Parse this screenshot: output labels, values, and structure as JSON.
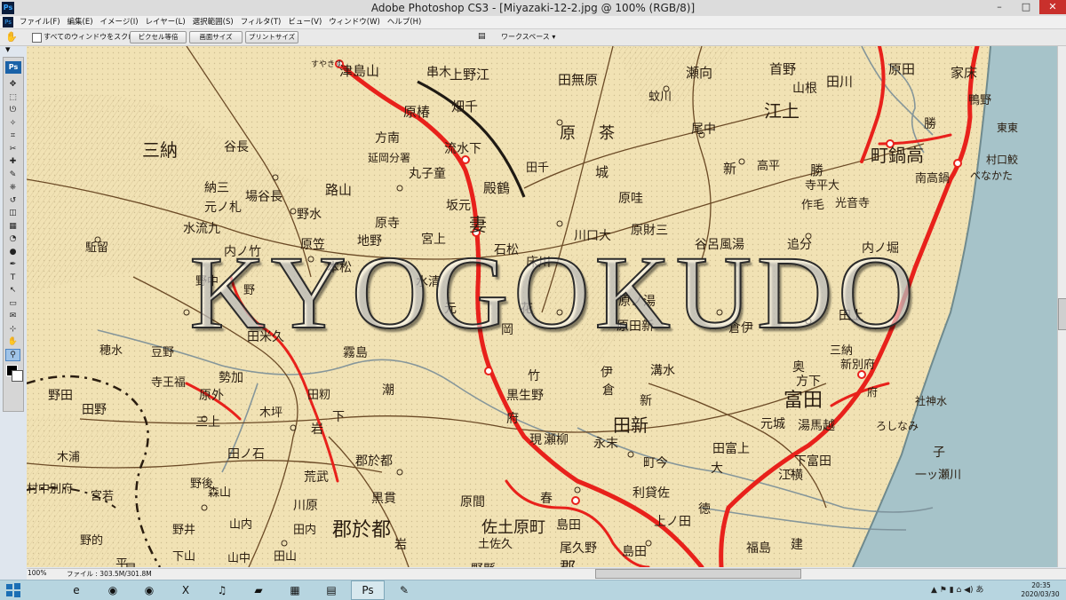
{
  "window": {
    "title": "Adobe Photoshop CS3 - [Miyazaki-12-2.jpg @ 100% (RGB/8)]",
    "app_icon_text": "Ps",
    "controls": {
      "minimize": "–",
      "maximize": "□",
      "close": "✕"
    }
  },
  "menu": {
    "items": [
      "ファイル(F)",
      "編集(E)",
      "イメージ(I)",
      "レイヤー(L)",
      "選択範囲(S)",
      "フィルタ(T)",
      "ビュー(V)",
      "ウィンドウ(W)",
      "ヘルプ(H)"
    ]
  },
  "options": {
    "scroll_all_label": "すべてのウィンドウをスクロール",
    "actual_pixels": "ピクセル等倍",
    "fit_screen": "画面サイズ",
    "print_size": "プリントサイズ",
    "workspace_label": "ワークスペース ▾"
  },
  "toolbox": {
    "badge": "Ps",
    "tools": [
      "move-icon",
      "marquee-icon",
      "lasso-icon",
      "magic-wand-icon",
      "crop-icon",
      "slice-icon",
      "healing-icon",
      "brush-icon",
      "stamp-icon",
      "history-brush-icon",
      "eraser-icon",
      "gradient-icon",
      "blur-icon",
      "dodge-icon",
      "pen-icon",
      "type-icon",
      "path-select-icon",
      "shape-icon",
      "notes-icon",
      "eyedropper-icon",
      "hand-icon",
      "zoom-icon"
    ],
    "glyphs": [
      "✥",
      "⬚",
      "ᘎ",
      "✧",
      "⌗",
      "✂",
      "✚",
      "✎",
      "⎈",
      "↺",
      "◫",
      "▦",
      "◔",
      "●",
      "✒",
      "T",
      "↖",
      "▭",
      "✉",
      "⊹",
      "✋",
      "⚲"
    ],
    "active_tool_index": 21
  },
  "canvas": {
    "watermark": "KYOGOKUDO",
    "labels": [
      "津島山",
      "すやきす",
      "上野江",
      "田無原",
      "串木",
      "畑千",
      "原椿",
      "瀬向",
      "首野",
      "田川",
      "原田",
      "家床",
      "蚊川",
      "江上",
      "山根",
      "勝",
      "鴨野",
      "三納",
      "谷長",
      "流水下",
      "方南",
      "原",
      "茶",
      "尾中",
      "町鍋高",
      "南高鍋",
      "延岡分署",
      "丸子童",
      "田千",
      "松本",
      "多",
      "高平",
      "勝",
      "寺平大",
      "新",
      "城",
      "納三",
      "場谷長",
      "路山",
      "殿鶴",
      "原哇",
      "谷子",
      "作毛",
      "光音寺",
      "元ノ札",
      "坂元",
      "原豊",
      "水流九",
      "野水",
      "原寺",
      "地野",
      "宮上",
      "妻",
      "川口大",
      "原財三",
      "谷呂風湯",
      "追分",
      "内ノ堀",
      "内ノ竹",
      "原笠",
      "石松",
      "床川",
      "田町",
      "久野",
      "呂米",
      "新",
      "本松",
      "野中",
      "尾鈴",
      "原ノ湯",
      "原田新",
      "倉伊",
      "田上",
      "三納",
      "納三",
      "穂北",
      "水清",
      "元",
      "花",
      "穂",
      "杉",
      "田米久",
      "野豆",
      "奥",
      "方下",
      "新別府",
      "園",
      "町",
      "田下",
      "郡町",
      "勢加",
      "原外",
      "寺王福",
      "黒生野",
      "竹",
      "伊",
      "田新",
      "倉",
      "溝水",
      "新",
      "富田",
      "田富",
      "浜",
      "元城",
      "塚野",
      "田野",
      "田富上",
      "下富田",
      "湯馬越",
      "本城",
      "岩",
      "三上",
      "三ノ田",
      "木浦",
      "木坪",
      "筒府",
      "都於郡",
      "現",
      "瀬柳",
      "永末",
      "町今",
      "大",
      "江横",
      "十弓",
      "宮若",
      "村中別府",
      "野後",
      "森山",
      "荒武",
      "川原",
      "黒貫",
      "原間",
      "子",
      "島田",
      "佐土原町",
      "利貸佐",
      "上ノ田",
      "徳",
      "野井",
      "山内",
      "郡於都",
      "岩",
      "田内",
      "山中",
      "田山",
      "佐土原",
      "尾久野",
      "久保土",
      "下山",
      "星",
      "島田",
      "建",
      "福島",
      "的野",
      "小",
      "瓜",
      "野"
    ],
    "placed": [
      [
        352,
        18,
        "津島山",
        15
      ],
      [
        320,
        14,
        "すやきす",
        9
      ],
      [
        450,
        20,
        "串木",
        14
      ],
      [
        476,
        22,
        "上野江",
        15
      ],
      [
        598,
        28,
        "田無原",
        15
      ],
      [
        478,
        58,
        "畑千",
        15
      ],
      [
        424,
        64,
        "原椿",
        15
      ],
      [
        742,
        20,
        "瀬向",
        15
      ],
      [
        836,
        16,
        "首野",
        15
      ],
      [
        900,
        30,
        "田川",
        15
      ],
      [
        970,
        16,
        "原田",
        15
      ],
      [
        1040,
        20,
        "家床",
        15
      ],
      [
        700,
        48,
        "蚊川",
        13
      ],
      [
        830,
        60,
        "江上",
        20
      ],
      [
        862,
        38,
        "山根",
        14
      ],
      [
        1010,
        78,
        "勝",
        14
      ],
      [
        1060,
        52,
        "鴨野",
        13
      ],
      [
        130,
        104,
        "三納",
        20
      ],
      [
        222,
        104,
        "谷長",
        14
      ],
      [
        470,
        106,
        "流水下",
        14
      ],
      [
        392,
        94,
        "方南",
        14
      ],
      [
        600,
        86,
        "原",
        18
      ],
      [
        644,
        86,
        "茶",
        18
      ],
      [
        748,
        84,
        "尾中",
        14
      ],
      [
        950,
        110,
        "町鍋高",
        20
      ],
      [
        1000,
        140,
        "南高鍋",
        13
      ],
      [
        384,
        118,
        "延岡分署",
        12
      ],
      [
        430,
        134,
        "丸子童",
        14
      ],
      [
        562,
        128,
        "田千",
        13
      ],
      [
        822,
        126,
        "高平",
        13
      ],
      [
        882,
        130,
        "勝",
        15
      ],
      [
        876,
        148,
        "寺平大",
        13
      ],
      [
        784,
        128,
        "新",
        15
      ],
      [
        640,
        132,
        "城",
        15
      ],
      [
        910,
        168,
        "光音寺",
        13
      ],
      [
        872,
        170,
        "作毛",
        13
      ],
      [
        200,
        150,
        "納三",
        14
      ],
      [
        246,
        160,
        "場谷長",
        14
      ],
      [
        336,
        152,
        "路山",
        15
      ],
      [
        514,
        150,
        "殿鶴",
        15
      ],
      [
        666,
        162,
        "原哇",
        14
      ],
      [
        200,
        172,
        "元ノ札",
        14
      ],
      [
        472,
        170,
        "坂元",
        14
      ],
      [
        176,
        196,
        "水流九",
        14
      ],
      [
        304,
        180,
        "野水",
        14
      ],
      [
        392,
        190,
        "原寺",
        14
      ],
      [
        372,
        210,
        "地野",
        14
      ],
      [
        444,
        208,
        "宮上",
        14
      ],
      [
        498,
        188,
        "妻",
        20
      ],
      [
        616,
        204,
        "川口大",
        14
      ],
      [
        680,
        198,
        "原財三",
        14
      ],
      [
        752,
        214,
        "谷呂風湯",
        14
      ],
      [
        856,
        214,
        "追分",
        14
      ],
      [
        940,
        218,
        "内ノ堀",
        14
      ],
      [
        222,
        222,
        "内ノ竹",
        14
      ],
      [
        308,
        214,
        "原笠",
        14
      ],
      [
        526,
        220,
        "石松",
        14
      ],
      [
        562,
        234,
        "床川",
        14
      ],
      [
        66,
        218,
        "駈留",
        13
      ],
      [
        338,
        240,
        "本松",
        14
      ],
      [
        190,
        256,
        "野中",
        13
      ],
      [
        244,
        266,
        "野",
        13
      ],
      [
        666,
        278,
        "原ノ湯",
        14
      ],
      [
        664,
        306,
        "原田新",
        14
      ],
      [
        790,
        308,
        "倉伊",
        14
      ],
      [
        914,
        294,
        "田上",
        14
      ],
      [
        904,
        334,
        "三納",
        13
      ],
      [
        438,
        256,
        "水清",
        14
      ],
      [
        470,
        286,
        "元",
        14
      ],
      [
        556,
        286,
        "花",
        14
      ],
      [
        534,
        310,
        "岡",
        14
      ],
      [
        248,
        318,
        "田米久",
        14
      ],
      [
        140,
        336,
        "豆野",
        13
      ],
      [
        82,
        334,
        "穂水",
        13
      ],
      [
        862,
        352,
        "奥",
        14
      ],
      [
        866,
        368,
        "方下",
        14
      ],
      [
        916,
        350,
        "新別府",
        13
      ],
      [
        356,
        336,
        "霧島",
        14
      ],
      [
        400,
        378,
        "潮",
        14
      ],
      [
        316,
        384,
        "田籾",
        13
      ],
      [
        216,
        364,
        "勢加",
        14
      ],
      [
        194,
        384,
        "原外",
        14
      ],
      [
        140,
        370,
        "寺王福",
        13
      ],
      [
        540,
        384,
        "黒生野",
        14
      ],
      [
        564,
        362,
        "竹",
        14
      ],
      [
        646,
        358,
        "伊",
        14
      ],
      [
        648,
        378,
        "倉",
        14
      ],
      [
        702,
        356,
        "溝水",
        14
      ],
      [
        690,
        390,
        "新",
        14
      ],
      [
        660,
        414,
        "田新",
        20
      ],
      [
        852,
        384,
        "富田",
        22
      ],
      [
        826,
        416,
        "元城",
        14
      ],
      [
        868,
        418,
        "湯馬越",
        14
      ],
      [
        24,
        384,
        "野田",
        14
      ],
      [
        62,
        400,
        "田野",
        14
      ],
      [
        772,
        444,
        "田富上",
        14
      ],
      [
        864,
        458,
        "下富田",
        14
      ],
      [
        190,
        414,
        "三上",
        14
      ],
      [
        226,
        450,
        "田ノ石",
        14
      ],
      [
        34,
        454,
        "木浦",
        13
      ],
      [
        262,
        404,
        "木坪",
        13
      ],
      [
        320,
        422,
        "岩",
        14
      ],
      [
        344,
        408,
        "下",
        14
      ],
      [
        370,
        458,
        "郡於都",
        14
      ],
      [
        540,
        410,
        "府",
        14
      ],
      [
        566,
        434,
        "現",
        14
      ],
      [
        582,
        434,
        "瀬柳",
        14
      ],
      [
        638,
        438,
        "永末",
        14
      ],
      [
        694,
        460,
        "町今",
        14
      ],
      [
        770,
        466,
        "大",
        14
      ],
      [
        846,
        474,
        "江横",
        14
      ],
      [
        1000,
        474,
        "一ッ瀬川",
        13
      ],
      [
        72,
        498,
        "宮若",
        13
      ],
      [
        0,
        490,
        "村中別府",
        13
      ],
      [
        184,
        484,
        "野後",
        13
      ],
      [
        204,
        494,
        "森山",
        13
      ],
      [
        312,
        476,
        "荒武",
        14
      ],
      [
        300,
        508,
        "川原",
        14
      ],
      [
        388,
        500,
        "黒貫",
        14
      ],
      [
        488,
        504,
        "原間",
        14
      ],
      [
        578,
        500,
        "春",
        14
      ],
      [
        596,
        530,
        "島田",
        14
      ],
      [
        512,
        530,
        "佐土原町",
        18
      ],
      [
        682,
        494,
        "利貸佐",
        14
      ],
      [
        706,
        526,
        "上ノ田",
        14
      ],
      [
        756,
        512,
        "徳",
        14
      ],
      [
        164,
        536,
        "野井",
        13
      ],
      [
        228,
        530,
        "山内",
        13
      ],
      [
        344,
        530,
        "郡於都",
        22
      ],
      [
        300,
        536,
        "田内",
        13
      ],
      [
        414,
        552,
        "岩",
        14
      ],
      [
        226,
        568,
        "山中",
        13
      ],
      [
        278,
        566,
        "田山",
        13
      ],
      [
        508,
        552,
        "土佐久",
        13
      ],
      [
        600,
        556,
        "尾久野",
        14
      ],
      [
        670,
        560,
        "島田",
        14
      ],
      [
        164,
        566,
        "下山",
        13
      ],
      [
        110,
        580,
        "星",
        14
      ],
      [
        60,
        548,
        "野的",
        13
      ],
      [
        810,
        556,
        "福島",
        14
      ],
      [
        860,
        552,
        "建",
        14
      ],
      [
        500,
        580,
        "野縣",
        14
      ],
      [
        600,
        576,
        "郡",
        18
      ],
      [
        100,
        574,
        "平",
        14
      ],
      [
        1020,
        448,
        "子",
        14
      ]
    ],
    "side_labels": [
      [
        1080,
        132,
        "村口鮫"
      ],
      [
        1062,
        150,
        "べなかた"
      ],
      [
        1000,
        404,
        "社神水"
      ],
      [
        946,
        394,
        "府"
      ],
      [
        956,
        432,
        "ろしなみ"
      ],
      [
        1092,
        96,
        "東東"
      ]
    ]
  },
  "status": {
    "zoom": "100%",
    "file_info": "ファイル : 303.5M/301.8M"
  },
  "taskbar": {
    "apps": [
      "ie-icon",
      "chrome-icon",
      "chrome-alt-icon",
      "excel-icon",
      "itunes-icon",
      "app-icon",
      "calculator-icon",
      "sticky-notes-icon",
      "photoshop-icon",
      "paint-icon"
    ],
    "app_glyphs": [
      "e",
      "◉",
      "◉",
      "X",
      "♫",
      "▰",
      "▦",
      "▤",
      "Ps",
      "✎"
    ],
    "active_index": 8,
    "tray": "▲ ⚑ ▮ ⌂ ◀) あ",
    "time": "20:35",
    "date": "2020/03/30"
  },
  "colors": {
    "rail_red": "#e8211b",
    "road_brown": "#6b4a26",
    "river_gray": "#7a8e98",
    "sea": "#a6c3c9",
    "land": "#f1e2b4"
  }
}
